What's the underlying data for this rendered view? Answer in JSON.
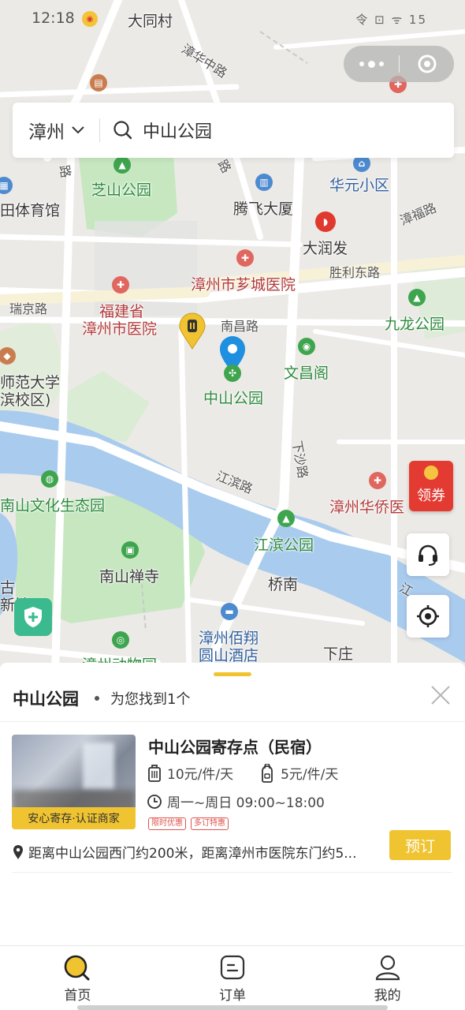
{
  "status_bar": {
    "time": "12:18",
    "right_text": "令 ⊡ ᯤ 15"
  },
  "capsule": {
    "more_icon": "more-dots-icon",
    "close_icon": "target-circle-icon"
  },
  "search": {
    "city": "漳州",
    "query": "中山公园"
  },
  "map": {
    "labels": {
      "datong_village": "大同村",
      "zhanghua_middle_road": "漳华中路",
      "zhishan_park": "芝山公园",
      "stadium": "田体育馆",
      "tengfei_mansion": "腾飞大厦",
      "huayuan_community": "华元小区",
      "zhangfu_road": "漳福路",
      "darunfa": "大润发",
      "shengli_east_road": "胜利东路",
      "xiangcheng_hospital": "漳州市芗城医院",
      "ruijing_road": "瑞京路",
      "fujian_hospital_line1": "福建省",
      "fujian_hospital_line2": "漳州市医院",
      "nanchang_road": "南昌路",
      "jiulong_park": "九龙公园",
      "normal_univ_line1": "师范大学",
      "normal_univ_line2": "滨校区)",
      "wenchang_pavilion": "文昌阁",
      "zhongshan_park": "中山公园",
      "xiasha_road": "下沙路",
      "jiangbin_road": "江滨路",
      "nanshan_eco_park": "南山文化生态园",
      "overseas_hospital": "漳州华侨医",
      "jiangbin_park": "江滨公园",
      "nanshan_temple": "南山禅寺",
      "qiaonan": "桥南",
      "hotel_line1": "漳州佰翔",
      "hotel_line2": "圆山酒店",
      "xiazhuang": "下庄",
      "zoo": "漳州动物园",
      "left_edge_1": "古",
      "left_edge_2": "新馆",
      "right_edge_river": "江",
      "road_top": "路",
      "road_left": "路"
    }
  },
  "coupon": {
    "label": "领券"
  },
  "results": {
    "title": "中山公园",
    "count_text": "为您找到1个",
    "items": [
      {
        "name": "中山公园寄存点（民宿）",
        "price_per_item": "10元/件/天",
        "price_small": "5元/件/天",
        "hours": "周一~周日 09:00~18:00",
        "badge": "安心寄存·认证商家",
        "tags": [
          "限时优惠",
          "多订特惠"
        ],
        "distance": "距离中山公园西门约200米，距离漳州市医院东门约5...",
        "book_label": "预订"
      }
    ]
  },
  "tabs": [
    {
      "label": "首页",
      "icon": "search-home-icon",
      "active": true
    },
    {
      "label": "订单",
      "icon": "order-icon",
      "active": false
    },
    {
      "label": "我的",
      "icon": "profile-icon",
      "active": false
    }
  ],
  "colors": {
    "accent": "#f0c431",
    "map_bg": "#eceae6",
    "river": "#a9cbee",
    "park": "#c6e7c0",
    "tag_red": "#e0544d"
  }
}
